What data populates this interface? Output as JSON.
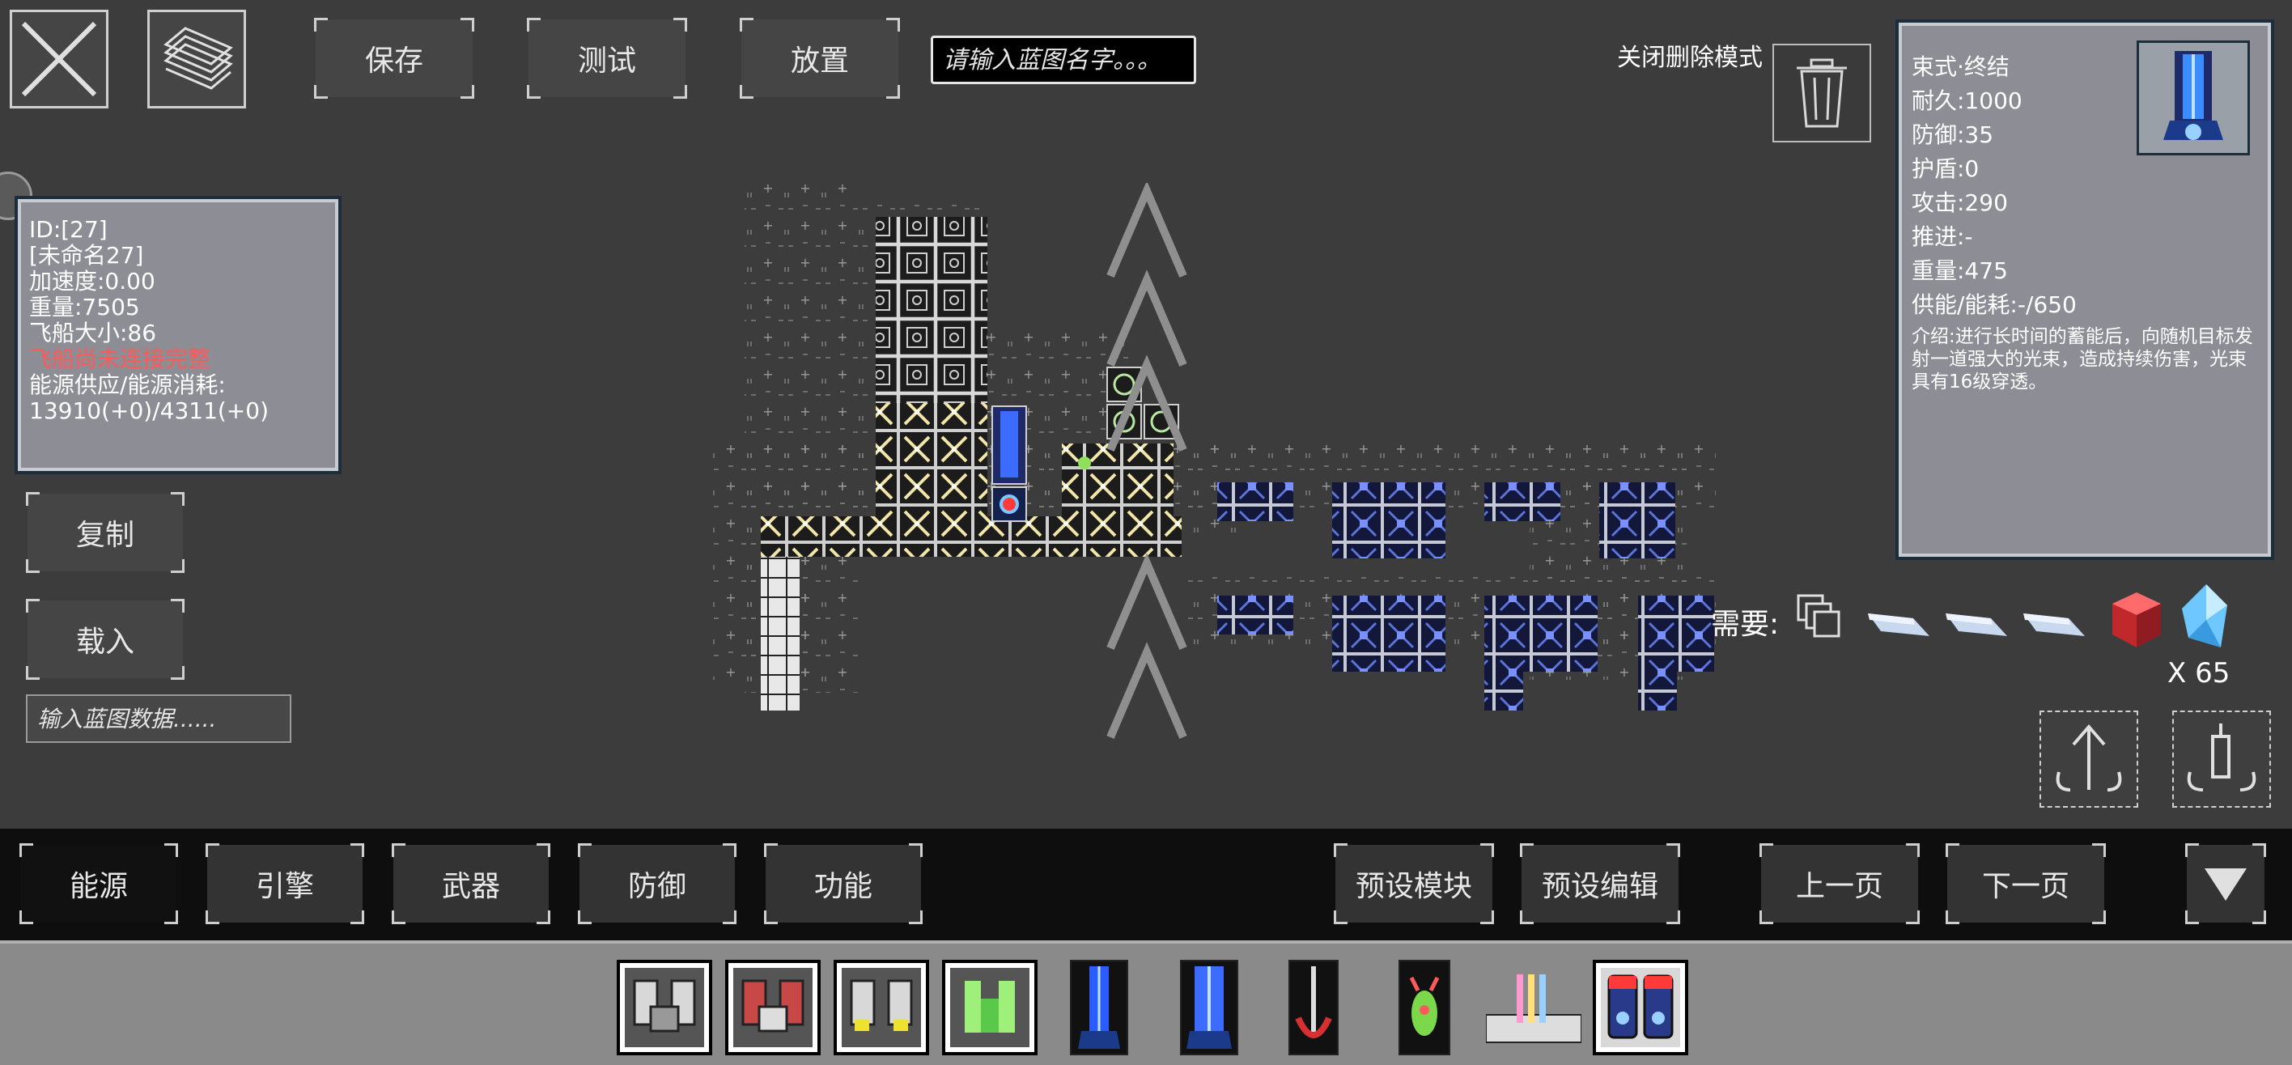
{
  "toolbar": {
    "save_label": "保存",
    "test_label": "测试",
    "place_label": "放置",
    "name_placeholder": "请输入蓝图名字。。。",
    "delete_mode_label": "关闭删除模式"
  },
  "ship_info": {
    "id": "ID:[27]",
    "name": "[未命名27]",
    "acceleration": "加速度:0.00",
    "weight": "重量:7505",
    "size": "飞船大小:86",
    "warning": "飞船尚未连接完整",
    "energy_label": "能源供应/能源消耗:",
    "energy_value": "13910(+0)/4311(+0)"
  },
  "left_buttons": {
    "copy_label": "复制",
    "load_label": "载入",
    "data_placeholder": "输入蓝图数据......"
  },
  "part_info": {
    "name": "束式·终结",
    "durability": "耐久:1000",
    "defense": "防御:35",
    "shield": "护盾:0",
    "attack": "攻击:290",
    "thrust": "推进:-",
    "weight": "重量:475",
    "power": "供能/能耗:-/650",
    "description": "介绍:进行长时间的蓄能后，向随机目标发射一道强大的光束，造成持续伤害，光束具有16级穿透。"
  },
  "requirements": {
    "label": "需要:",
    "count": "X 65"
  },
  "categories": [
    {
      "label": "能源"
    },
    {
      "label": "引擎"
    },
    {
      "label": "武器"
    },
    {
      "label": "防御"
    },
    {
      "label": "功能"
    }
  ],
  "bottom_nav": {
    "preset_module": "预设模块",
    "preset_edit": "预设编辑",
    "prev_page": "上一页",
    "next_page": "下一页"
  },
  "colors": {
    "warning": "#ff5a5a",
    "background": "#3c3c3c",
    "panel": "#8d8d95",
    "tray": "#8a8a8a"
  }
}
